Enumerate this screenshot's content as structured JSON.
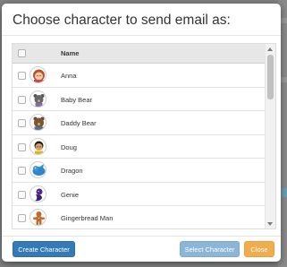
{
  "dialog": {
    "title": "Choose character to send email as:"
  },
  "table": {
    "header_name": "Name",
    "rows": [
      {
        "name": "Anna",
        "avatar_icon": "anna-avatar-icon"
      },
      {
        "name": "Baby Bear",
        "avatar_icon": "baby-bear-avatar-icon"
      },
      {
        "name": "Daddy Bear",
        "avatar_icon": "daddy-bear-avatar-icon"
      },
      {
        "name": "Doug",
        "avatar_icon": "doug-avatar-icon"
      },
      {
        "name": "Dragon",
        "avatar_icon": "dragon-avatar-icon"
      },
      {
        "name": "Genie",
        "avatar_icon": "genie-avatar-icon"
      },
      {
        "name": "Gingerbread Man",
        "avatar_icon": "gingerbread-man-avatar-icon"
      }
    ]
  },
  "buttons": {
    "create": "Create Character",
    "select": "Select Character",
    "close": "Close"
  },
  "colors": {
    "primary": "#337ab7",
    "primary_disabled": "#8bb6d8",
    "warning": "#f0ad4e"
  }
}
